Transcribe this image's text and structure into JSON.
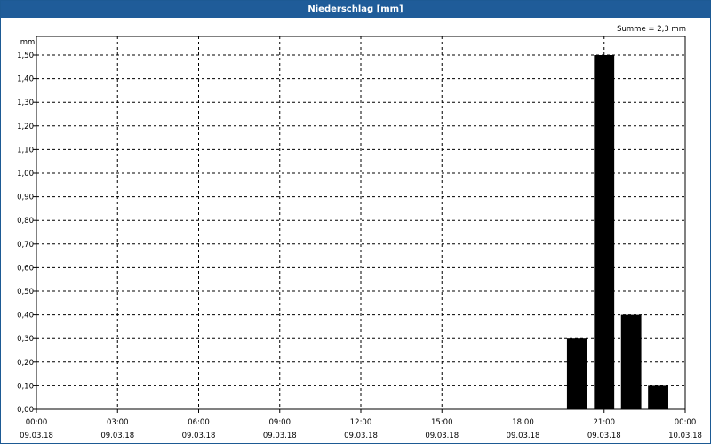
{
  "window": {
    "title": "Niederschlag [mm]"
  },
  "summary": "Summe = 2,3 mm",
  "colors": {
    "titlebar": "#1f5c99",
    "bars": "#000000",
    "grid": "#000000"
  },
  "chart_data": {
    "type": "bar",
    "title": "Niederschlag [mm]",
    "ylabel": "mm",
    "ylim": [
      0,
      1.6
    ],
    "yticks": [
      "0,00",
      "0,10",
      "0,20",
      "0,30",
      "0,40",
      "0,50",
      "0,60",
      "0,70",
      "0,80",
      "0,90",
      "1,00",
      "1,10",
      "1,20",
      "1,30",
      "1,40",
      "1,50"
    ],
    "xlim_hours": [
      0,
      24
    ],
    "xticks": [
      {
        "time": "00:00",
        "date": "09.03.18"
      },
      {
        "time": "03:00",
        "date": "09.03.18"
      },
      {
        "time": "06:00",
        "date": "09.03.18"
      },
      {
        "time": "09:00",
        "date": "09.03.18"
      },
      {
        "time": "12:00",
        "date": "09.03.18"
      },
      {
        "time": "15:00",
        "date": "09.03.18"
      },
      {
        "time": "18:00",
        "date": "09.03.18"
      },
      {
        "time": "21:00",
        "date": "09.03.18"
      },
      {
        "time": "00:00",
        "date": "10.03.18"
      }
    ],
    "grid": true,
    "bars": [
      {
        "time": "20:00",
        "value": 0.3
      },
      {
        "time": "21:00",
        "value": 1.5
      },
      {
        "time": "22:00",
        "value": 0.4
      },
      {
        "time": "23:00",
        "value": 0.1
      }
    ]
  }
}
